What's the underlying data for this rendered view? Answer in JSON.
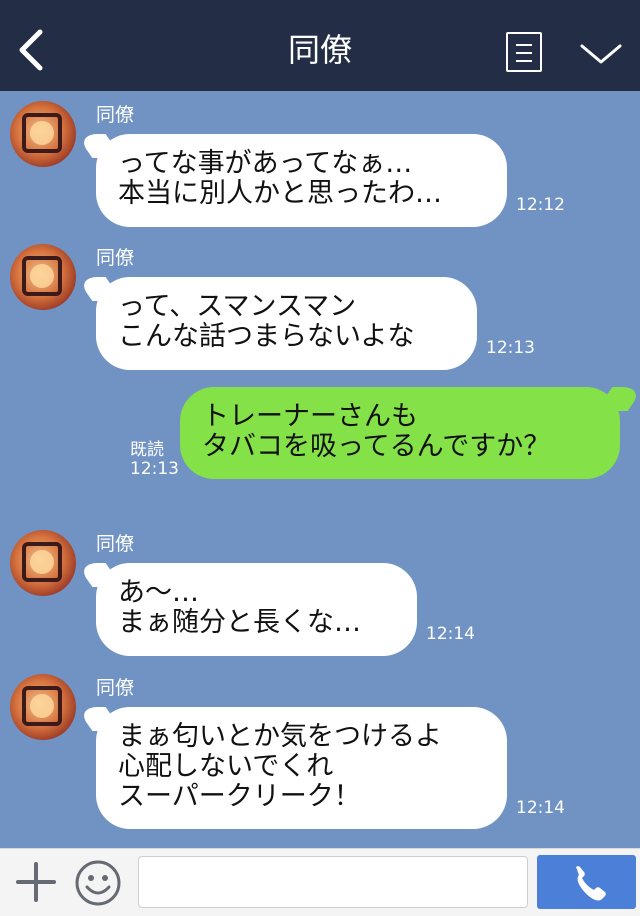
{
  "header": {
    "title": "同僚",
    "back_icon": "chevron-left-icon",
    "menu_icon": "menu-list-icon",
    "collapse_icon": "chevron-down-icon"
  },
  "messages": [
    {
      "sender": "同僚",
      "text": "ってな事があってなぁ…\n本当に別人かと思ったわ…",
      "time": "12:12"
    },
    {
      "sender": "同僚",
      "text": "って、スマンスマン\nこんな話つまらないよな",
      "time": "12:13"
    },
    {
      "sender": "",
      "text": "トレーナーさんも\nタバコを吸ってるんですか？",
      "read": "既読",
      "time": "12:13"
    },
    {
      "sender": "同僚",
      "text": "あ〜…\nまぁ随分と長くな…",
      "time": "12:14"
    },
    {
      "sender": "同僚",
      "text": "まぁ匂いとか気をつけるよ\n心配しないでくれ\nスーパークリーク！",
      "time": "12:14"
    }
  ],
  "footer": {
    "plus_icon": "plus-icon",
    "emoji_icon": "smiley-icon",
    "input_value": "",
    "send_icon": "phone-icon"
  },
  "colors": {
    "header_bg": "#232d45",
    "chat_bg": "#7093c4",
    "incoming_bubble": "#ffffff",
    "outgoing_bubble": "#84e148",
    "call_button": "#4c7fd8"
  }
}
